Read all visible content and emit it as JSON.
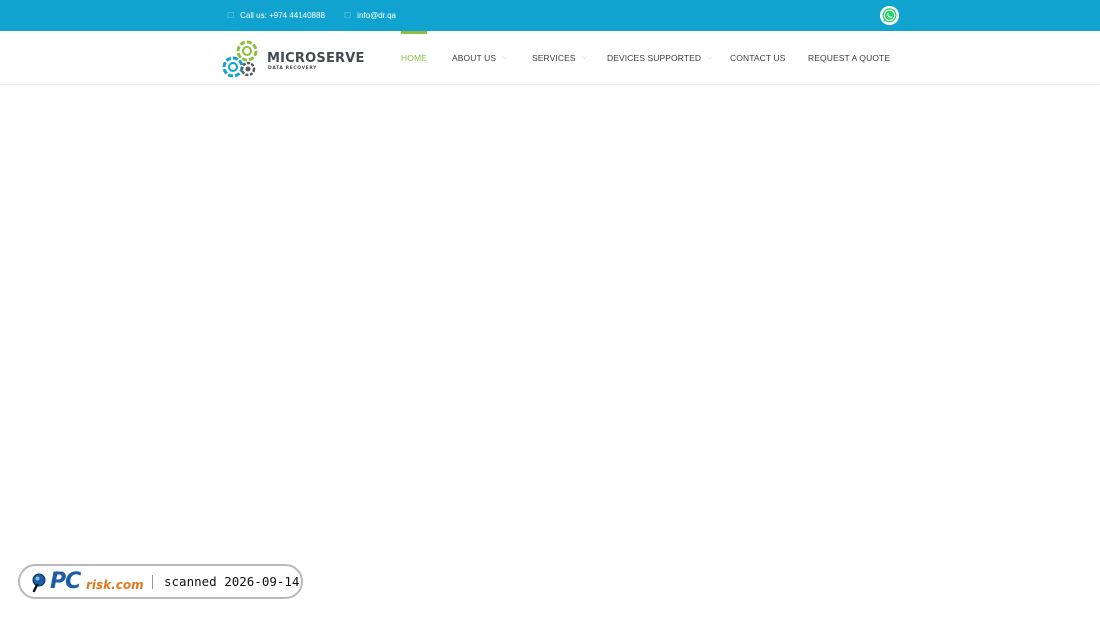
{
  "topbar": {
    "phone_label": "Call us: +974 44140888",
    "email_label": "info@dr.qa",
    "whatsapp_icon": "whatsapp-icon",
    "bg_color": "#10a3cf"
  },
  "brand": {
    "name": "MICROSERVE",
    "tagline": "DATA RECOVERY"
  },
  "nav": {
    "items": [
      {
        "label": "HOME",
        "active": true
      },
      {
        "label": "ABOUT US",
        "has_dropdown": true
      },
      {
        "label": "SERVICES",
        "has_dropdown": true
      },
      {
        "label": "DEVICES SUPPORTED",
        "has_dropdown": true
      },
      {
        "label": "CONTACT US"
      },
      {
        "label": "REQUEST A QUOTE"
      }
    ],
    "active_color": "#8cbf3f"
  },
  "watermark": {
    "brand_pc": "PC",
    "brand_rest": "risk.com",
    "scan_text": "scanned 2026-09-14"
  }
}
